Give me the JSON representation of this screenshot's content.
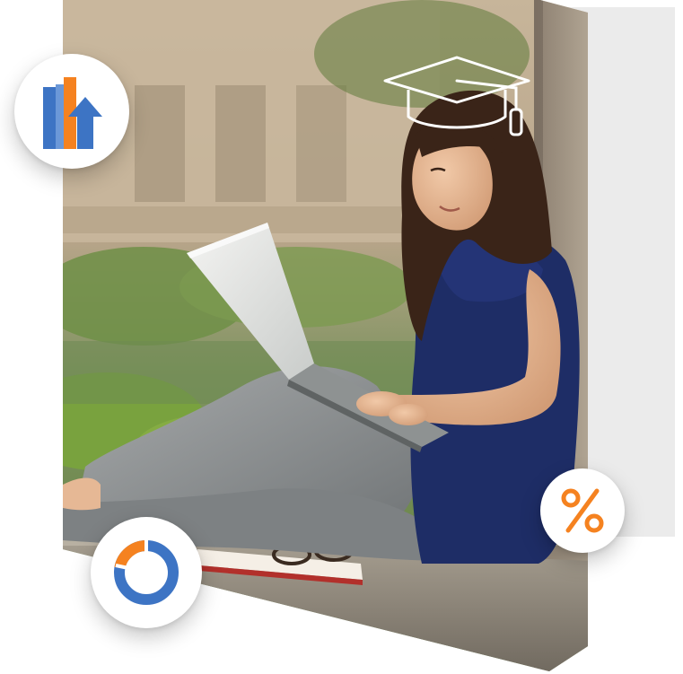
{
  "scene": {
    "subject": "woman-with-laptop",
    "icons": {
      "graduation_cap": "graduation-cap-icon",
      "bar_chart": "bar-chart-growth-icon",
      "donut": "donut-chart-icon",
      "percent": "percent-icon"
    }
  },
  "colors": {
    "brand_orange": "#f58220",
    "brand_blue": "#3d74c4",
    "backdrop_gray": "#ebebeb",
    "badge_white": "#ffffff"
  },
  "chart_badge": {
    "bar_levels": [
      0.86,
      1.0,
      0.48
    ]
  },
  "donut_badge": {
    "highlight_fraction": 0.22
  }
}
